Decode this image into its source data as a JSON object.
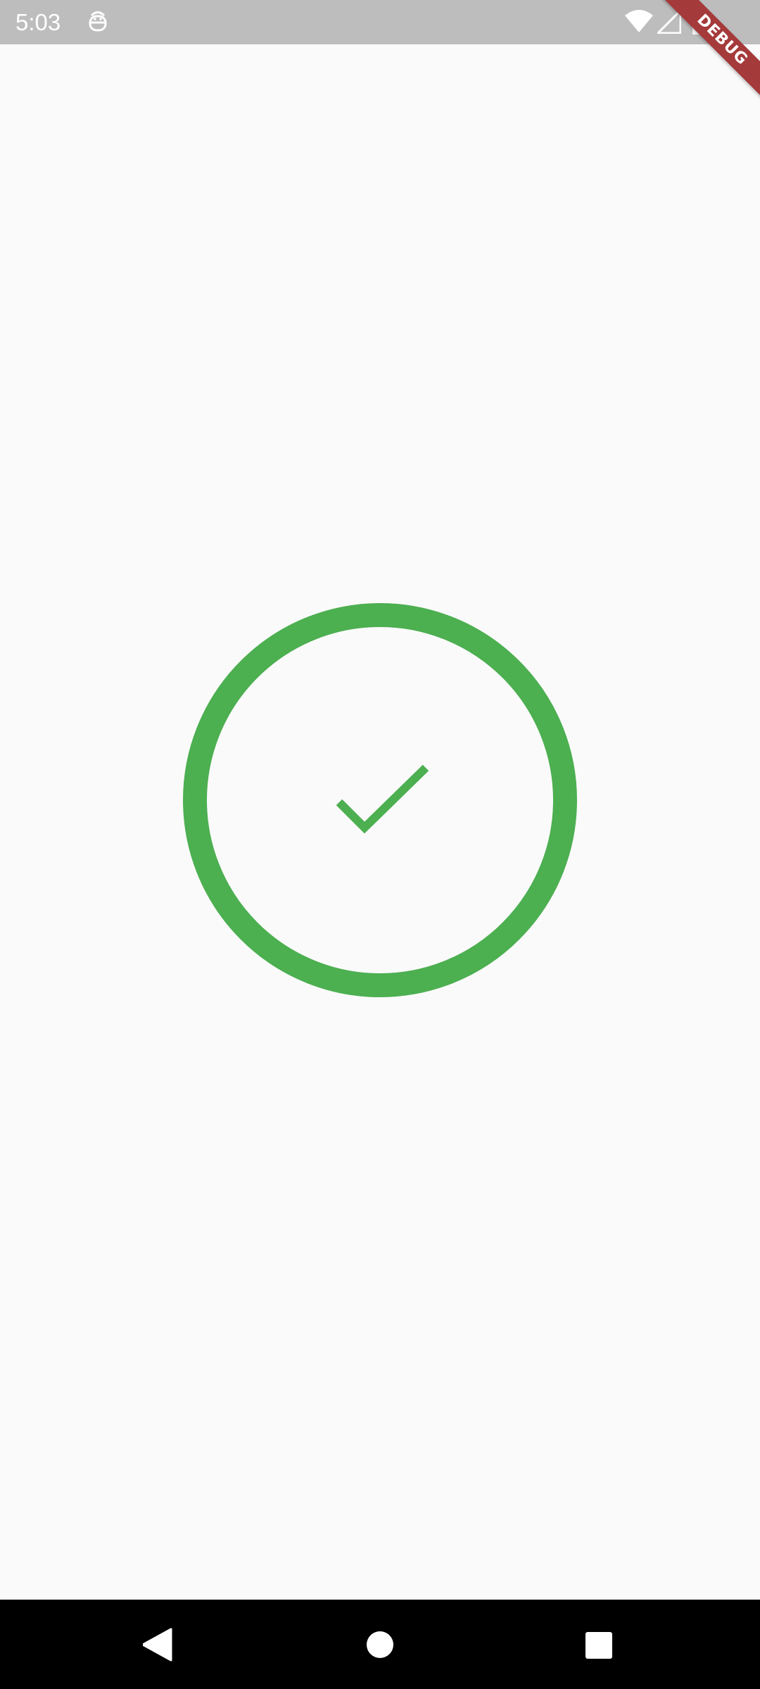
{
  "status_bar": {
    "time": "5:03",
    "icons": [
      "debug-app-icon",
      "wifi-icon",
      "signal-icon",
      "battery-icon"
    ],
    "background_color": "#bdbdbd"
  },
  "debug_banner": {
    "label": "DEBUG",
    "color": "#a53a3a"
  },
  "main": {
    "indicator": {
      "icon": "check-circle-icon",
      "color": "#4caf50"
    },
    "background_color": "#fafafa"
  },
  "nav_bar": {
    "buttons": [
      "back-icon",
      "home-icon",
      "recents-icon"
    ],
    "background_color": "#000000"
  }
}
